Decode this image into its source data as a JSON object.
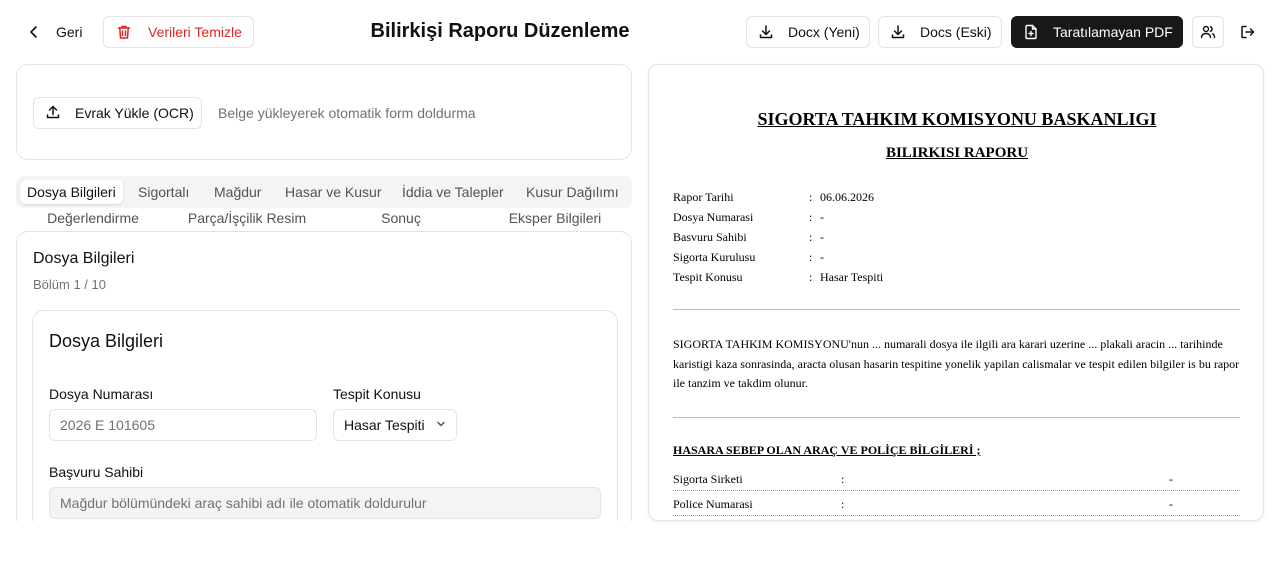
{
  "header": {
    "back_label": "Geri",
    "clear_label": "Verileri Temizle",
    "title": "Bilirkişi Raporu Düzenleme",
    "docx_label": "Docx (Yeni)",
    "docs_label": "Docs (Eski)",
    "pdf_label": "Taratılamayan PDF"
  },
  "upload": {
    "button_label": "Evrak Yükle (OCR)",
    "hint": "Belge yükleyerek otomatik form doldurma"
  },
  "tabs": [
    {
      "label": "Dosya Bilgileri",
      "active": true
    },
    {
      "label": "Sigortalı"
    },
    {
      "label": "Mağdur"
    },
    {
      "label": "Hasar ve Kusur"
    },
    {
      "label": "İddia ve Talepler"
    },
    {
      "label": "Kusur Dağılımı"
    },
    {
      "label": "Değerlendirme"
    },
    {
      "label": "Parça/İşçilik Resim"
    },
    {
      "label": "Sonuç"
    },
    {
      "label": "Eksper Bilgileri"
    }
  ],
  "section": {
    "title": "Dosya Bilgileri",
    "subtitle": "Bölüm 1 / 10",
    "card_title": "Dosya Bilgileri",
    "fields": {
      "dosya_numarasi": {
        "label": "Dosya Numarası",
        "placeholder": "2026 E 101605"
      },
      "tespit_konusu": {
        "label": "Tespit Konusu",
        "value": "Hasar Tespiti"
      },
      "basvuru_sahibi": {
        "label": "Başvuru Sahibi",
        "placeholder": "Mağdur bölümündeki araç sahibi adı ile otomatik doldurulur"
      }
    }
  },
  "document": {
    "title": "SIGORTA TAHKIM KOMISYONU BASKANLIGI",
    "subtitle": "BILIRKISI RAPORU",
    "meta": [
      {
        "key": "Rapor Tarihi",
        "value": "06.06.2026"
      },
      {
        "key": "Dosya Numarasi",
        "value": "-"
      },
      {
        "key": "Basvuru Sahibi",
        "value": "-"
      },
      {
        "key": "Sigorta Kurulusu",
        "value": "-"
      },
      {
        "key": "Tespit Konusu",
        "value": "Hasar Tespiti"
      }
    ],
    "paragraph": "SIGORTA TAHKIM KOMISYONU'nun ... numarali dosya ile ilgili ara karari uzerine ... plakali aracin ... tarihinde karistigi kaza sonrasinda, aracta olusan hasarin tespitine yonelik yapilan calismalar ve tespit edilen bilgiler is bu rapor ile tanzim ve takdim olunur.",
    "section_heading": "HASARA SEBEP OLAN ARAÇ VE POLİÇE BİLGİLERİ ;",
    "table": [
      {
        "key": "Sigorta Sirketi",
        "value": "-"
      },
      {
        "key": "Police Numarasi",
        "value": "-"
      }
    ]
  }
}
